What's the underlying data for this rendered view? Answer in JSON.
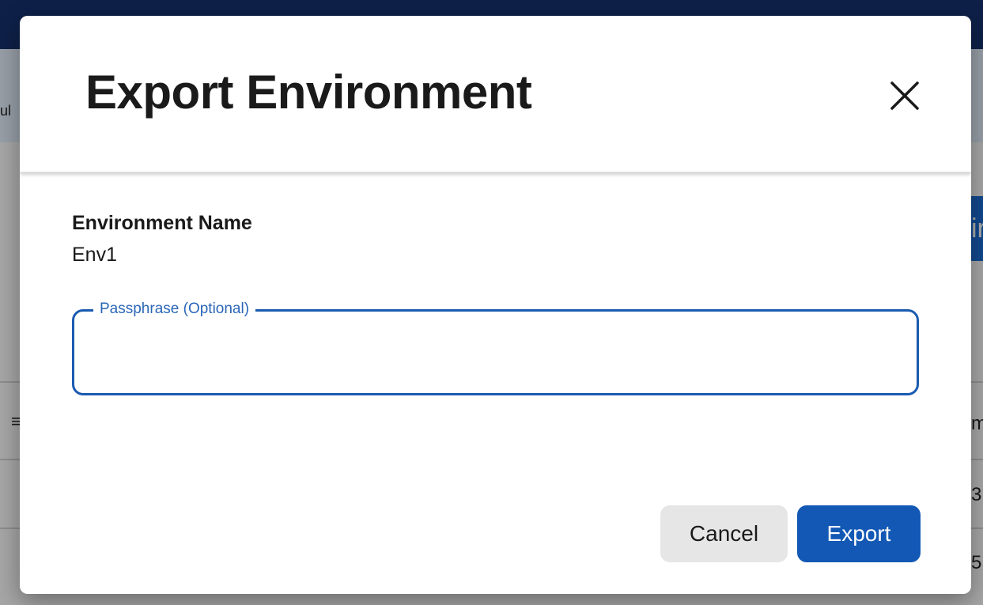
{
  "background": {
    "subbar_text": "ul",
    "right_button_char": "ir",
    "filter_icon": "filter-lines-icon",
    "col_header_char": "m",
    "row1_char": "3",
    "row2_char": "5"
  },
  "dialog": {
    "title": "Export Environment",
    "close_icon": "close-icon",
    "environment_name_label": "Environment Name",
    "environment_name_value": "Env1",
    "passphrase": {
      "label": "Passphrase (Optional)",
      "value": "",
      "placeholder": ""
    },
    "buttons": {
      "cancel": "Cancel",
      "export": "Export"
    }
  },
  "colors": {
    "primary": "#1258b4",
    "outline": "#1a5bb1",
    "label_blue": "#2a66b8",
    "topbar": "#16306a"
  }
}
